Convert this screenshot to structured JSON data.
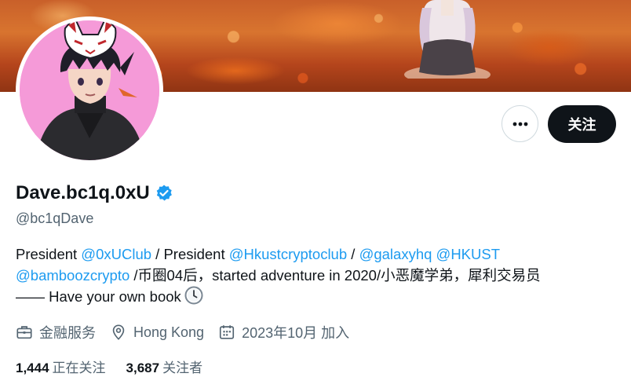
{
  "profile": {
    "display_name": "Dave.bc1q.0xU",
    "handle": "@bc1qDave",
    "verified": true,
    "follow_label": "关注",
    "more_icon": "more-horizontal-icon"
  },
  "bio": {
    "line1_a": "President ",
    "mention1": "@0xUClub",
    "line1_b": " / President ",
    "mention2": "@Hkustcryptoclub",
    "line1_c": " / ",
    "mention3": "@galaxyhq",
    "line1_d": " ",
    "mention4": "@HKUST",
    "mention5": "@bamboozcrypto",
    "line2_rest": " /币圈04后，started adventure in 2020/小恶魔学弟，犀利交易员",
    "line3": "—— Have your own book"
  },
  "meta": {
    "category": "金融服务",
    "location": "Hong Kong",
    "joined": "2023年10月 加入"
  },
  "stats": {
    "following_count": "1,444",
    "following_label": "正在关注",
    "followers_count": "3,687",
    "followers_label": "关注者"
  },
  "colors": {
    "accent": "#1d9bf0",
    "text": "#0f1419",
    "secondary": "#536471",
    "avatar_bg": "#f59ad8"
  }
}
